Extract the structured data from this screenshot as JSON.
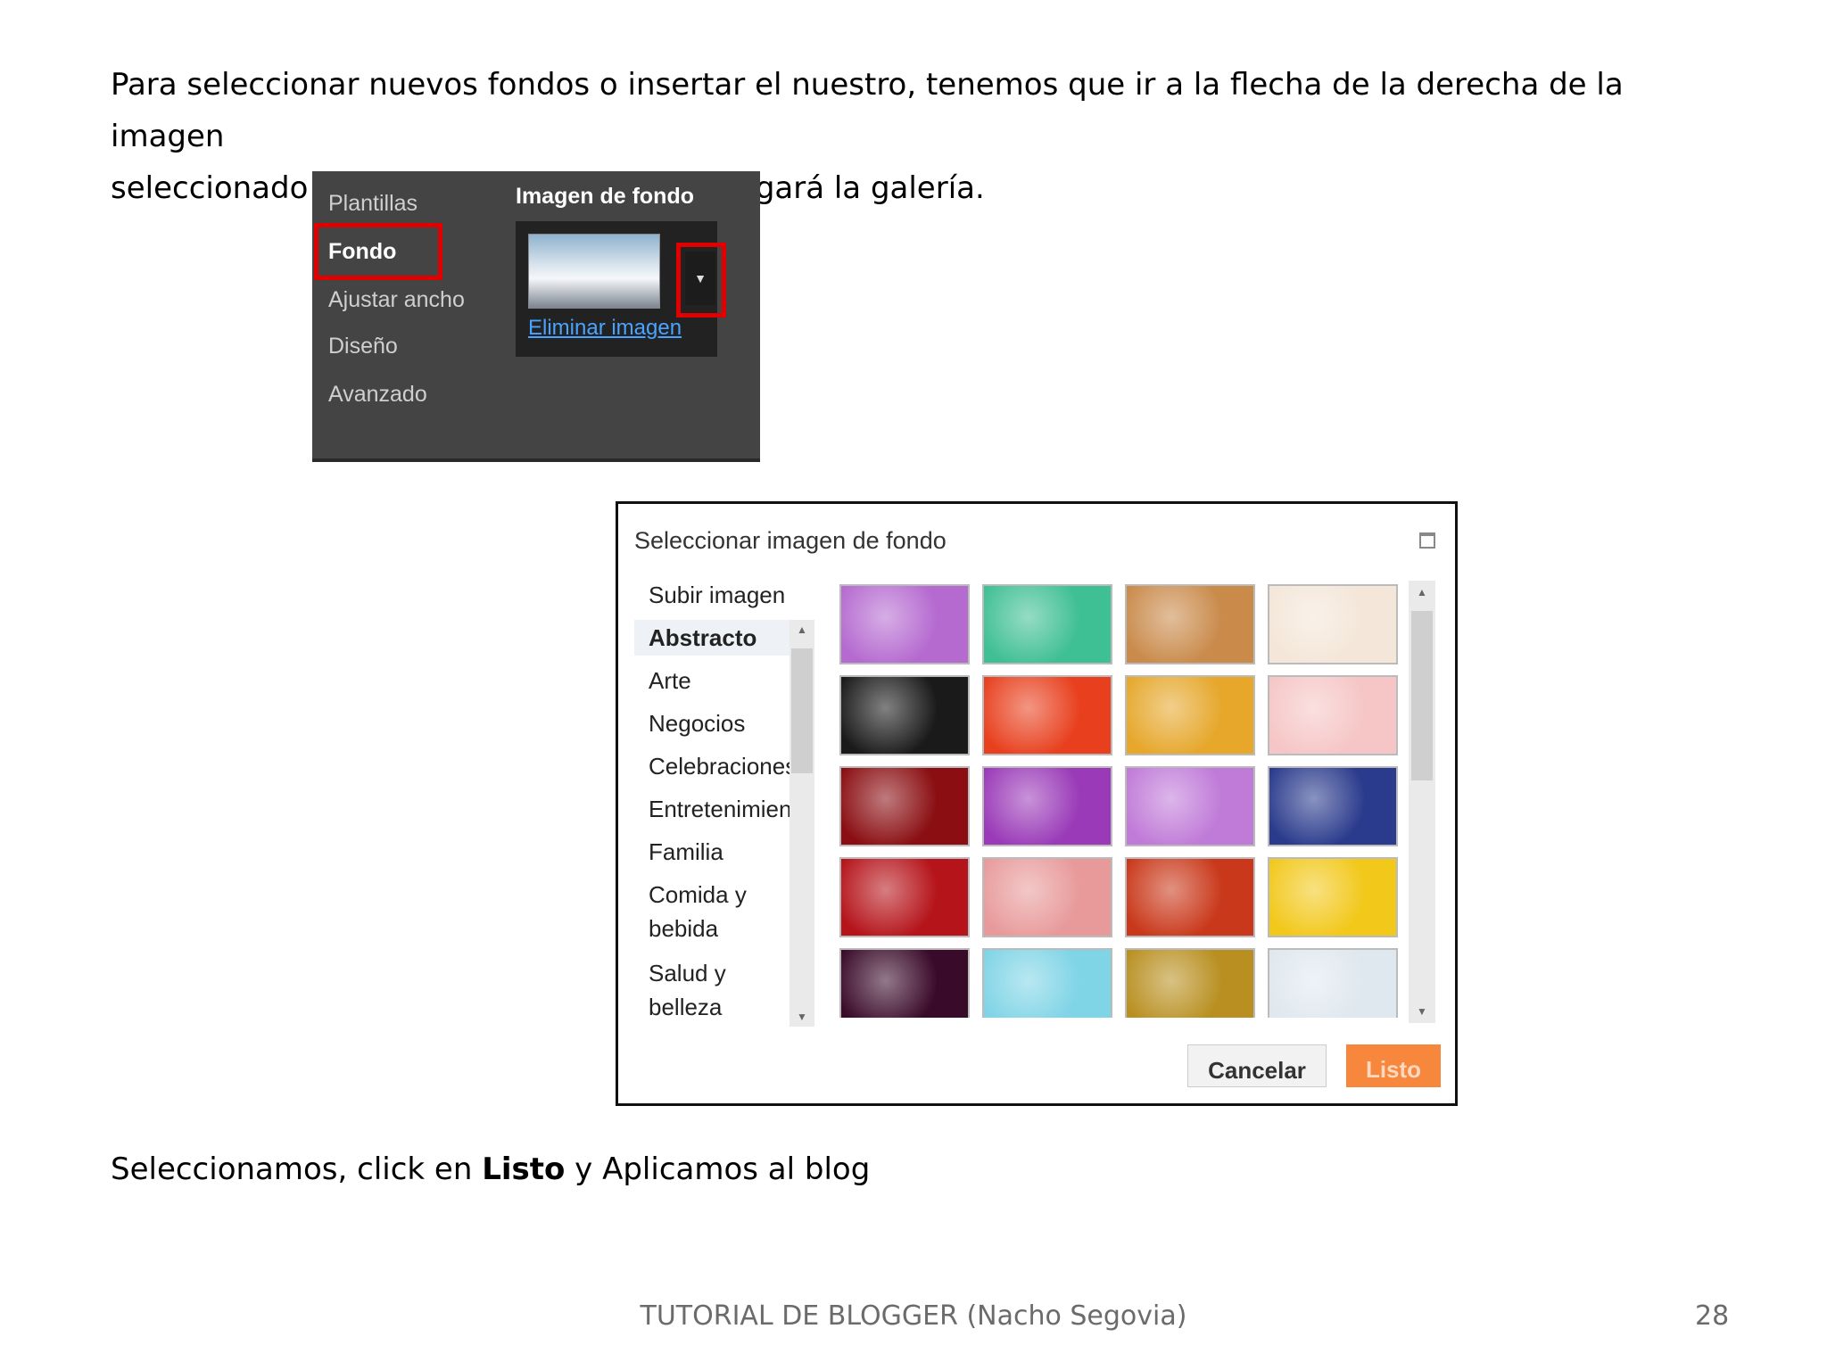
{
  "intro": {
    "line1": "Para seleccionar nuevos fondos o insertar el nuestro, tenemos que ir a la flecha de la derecha de la imagen",
    "line2": "seleccionado en ese momento y se desplegará la galería."
  },
  "designer_panel": {
    "nav": [
      "Plantillas",
      "Fondo",
      "Ajustar ancho",
      "Diseño",
      "Avanzado"
    ],
    "section_title": "Imagen de fondo",
    "remove_link": "Eliminar imagen",
    "highlight_color": "#e00000"
  },
  "dialog": {
    "title": "Seleccionar imagen de fondo",
    "upload": "Subir imagen",
    "active_category": "Abstracto",
    "categories": [
      "Arte",
      "Negocios",
      "Celebraciones",
      "Entretenimiento",
      "Familia",
      "Comida y",
      "bebida",
      "Salud y",
      "belleza"
    ],
    "cancel_label": "Cancelar",
    "done_label": "Listo",
    "thumbnails": [
      "#b56ad0",
      "#3fbf94",
      "#c98a4a",
      "#f4e6d8",
      "#1a1a1a",
      "#e8401e",
      "#e6a72b",
      "#f6c6c6",
      "#8a0e12",
      "#9a3ab8",
      "#c07ad8",
      "#2a3a8c",
      "#b5141a",
      "#e89a9a",
      "#c9381a",
      "#f2c81a",
      "#3a0a2a",
      "#7fd4e6",
      "#b88f20",
      "#dfe8ef"
    ]
  },
  "outro": {
    "before": "Seleccionamos, click en ",
    "bold": "Listo",
    "after": " y Aplicamos al blog"
  },
  "footer": {
    "title": "TUTORIAL DE BLOGGER (Nacho Segovia)",
    "page": "28"
  }
}
